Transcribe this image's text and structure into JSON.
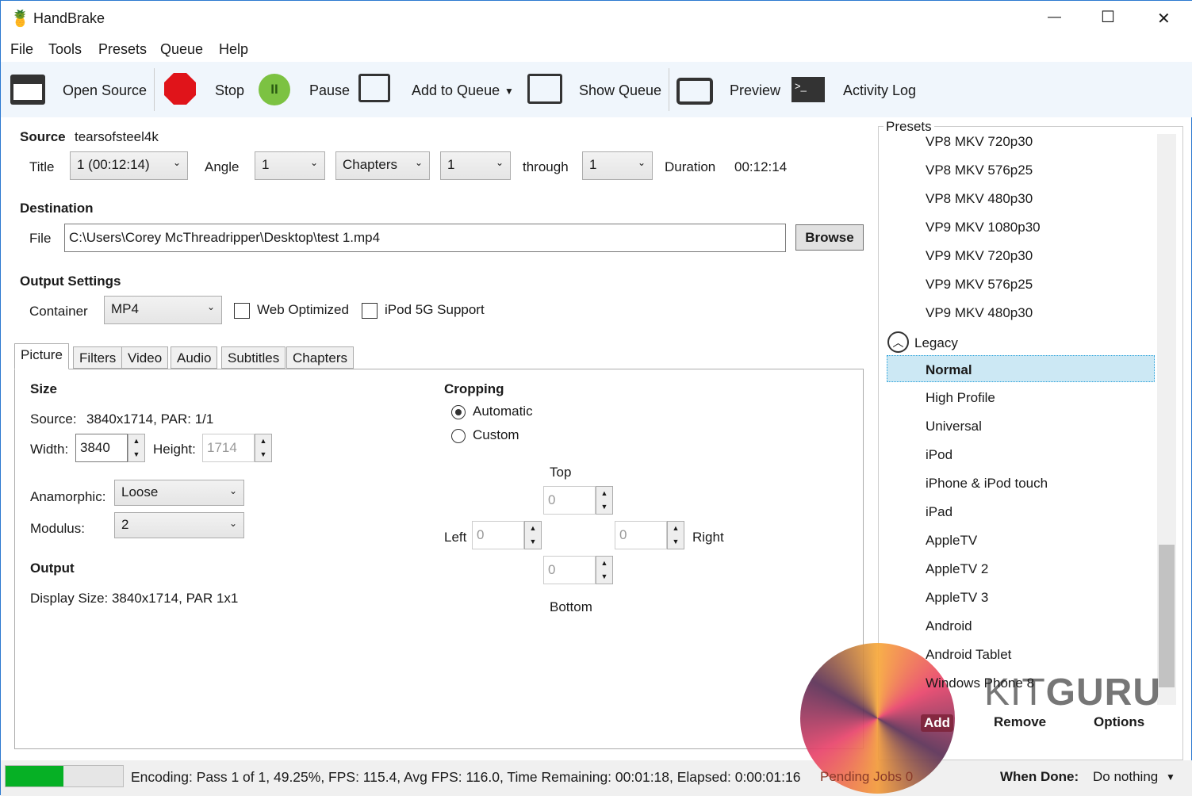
{
  "window": {
    "title": "HandBrake",
    "minimize": "—",
    "maximize": "☐",
    "close": "✕"
  },
  "menu": [
    "File",
    "Tools",
    "Presets",
    "Queue",
    "Help"
  ],
  "toolbar": {
    "open_source": "Open Source",
    "stop": "Stop",
    "pause": "Pause",
    "add_to_queue": "Add to Queue",
    "show_queue": "Show Queue",
    "preview": "Preview",
    "activity_log": "Activity Log"
  },
  "source": {
    "label": "Source",
    "name": "tearsofsteel4k",
    "title_label": "Title",
    "title_value": "1 (00:12:14)",
    "angle_label": "Angle",
    "angle_value": "1",
    "range_type": "Chapters",
    "range_start": "1",
    "through_label": "through",
    "range_end": "1",
    "duration_label": "Duration",
    "duration_value": "00:12:14"
  },
  "destination": {
    "label": "Destination",
    "file_label": "File",
    "file_value": "C:\\Users\\Corey McThreadripper\\Desktop\\test 1.mp4",
    "browse": "Browse"
  },
  "output": {
    "label": "Output Settings",
    "container_label": "Container",
    "container_value": "MP4",
    "web_optimized": "Web Optimized",
    "ipod": "iPod 5G Support"
  },
  "tabs": [
    "Picture",
    "Filters",
    "Video",
    "Audio",
    "Subtitles",
    "Chapters"
  ],
  "picture": {
    "size_label": "Size",
    "source_label": "Source:",
    "source_value": "3840x1714, PAR: 1/1",
    "width_label": "Width:",
    "width_value": "3840",
    "height_label": "Height:",
    "height_value": "1714",
    "anamorphic_label": "Anamorphic:",
    "anamorphic_value": "Loose",
    "modulus_label": "Modulus:",
    "modulus_value": "2",
    "output_label": "Output",
    "display_size": "Display Size: 3840x1714,  PAR 1x1",
    "cropping_label": "Cropping",
    "automatic": "Automatic",
    "custom": "Custom",
    "top": "Top",
    "left": "Left",
    "right": "Right",
    "bottom": "Bottom",
    "top_value": "0",
    "left_value": "0",
    "right_value": "0",
    "bottom_value": "0"
  },
  "presets": {
    "label": "Presets",
    "items_top": [
      "VP8 MKV 720p30",
      "VP8 MKV 576p25",
      "VP8 MKV 480p30",
      "VP9 MKV 1080p30",
      "VP9 MKV 720p30",
      "VP9 MKV 576p25",
      "VP9 MKV 480p30"
    ],
    "group": "Legacy",
    "selected": "Normal",
    "items": [
      "High Profile",
      "Universal",
      "iPod",
      "iPhone & iPod touch",
      "iPad",
      "AppleTV",
      "AppleTV 2",
      "AppleTV 3",
      "Android",
      "Android Tablet",
      "Windows Phone 8"
    ],
    "add": "Add",
    "remove": "Remove",
    "options": "Options"
  },
  "status": {
    "progress_percent": 49.25,
    "text": "Encoding: Pass 1 of 1,  49.25%, FPS: 115.4,  Avg FPS: 116.0,  Time Remaining: 00:01:18,  Elapsed: 0:00:01:16",
    "pending": "Pending Jobs 0",
    "when_done_label": "When Done:",
    "when_done_value": "Do nothing"
  },
  "watermark": "KITGURU",
  "colors": {
    "accent": "#2b79d0",
    "progress": "#06b025",
    "selected": "#cce8f4"
  }
}
